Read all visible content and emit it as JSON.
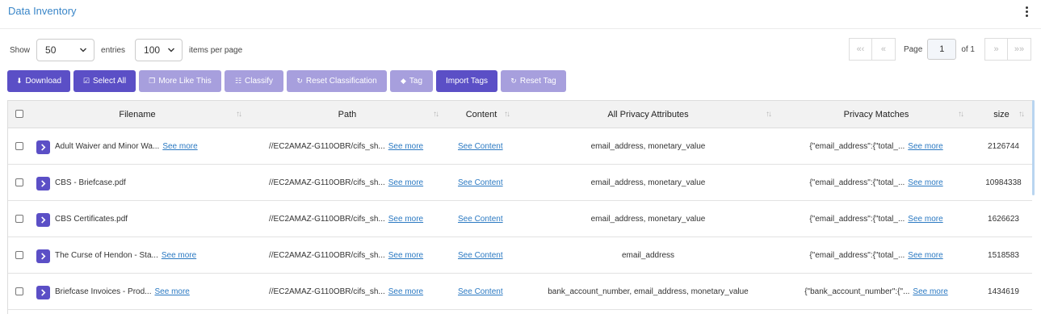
{
  "header": {
    "title": "Data Inventory",
    "menu_icon": "kebab-menu-icon"
  },
  "controls": {
    "show_label": "Show",
    "entries_value": "50",
    "entries_label": "entries",
    "items_value": "100",
    "items_label": "items per page"
  },
  "pagination": {
    "first": "«‹",
    "prev": "«",
    "page_label": "Page",
    "page_value": "1",
    "of_label": "of 1",
    "next": "»",
    "last": "»»"
  },
  "toolbar": {
    "download": "Download",
    "select_all": "Select All",
    "more_like_this": "More Like This",
    "classify": "Classify",
    "reset_classification": "Reset Classification",
    "tag": "Tag",
    "import_tags": "Import Tags",
    "reset_tag": "Reset Tag"
  },
  "table": {
    "columns": {
      "filename": "Filename",
      "path": "Path",
      "content": "Content",
      "privacy_attributes": "All Privacy Attributes",
      "privacy_matches": "Privacy Matches",
      "size": "size"
    },
    "see_more": "See more",
    "see_content": "See Content",
    "rows": [
      {
        "filename": "Adult Waiver and Minor Wa...",
        "path": "//EC2AMAZ-G110OBR/cifs_sh...",
        "attributes": "email_address, monetary_value",
        "matches": "{\"email_address\":{\"total_...",
        "size": "2126744"
      },
      {
        "filename": "CBS - Briefcase.pdf",
        "path": "//EC2AMAZ-G110OBR/cifs_sh...",
        "attributes": "email_address, monetary_value",
        "matches": "{\"email_address\":{\"total_...",
        "size": "10984338"
      },
      {
        "filename": "CBS Certificates.pdf",
        "path": "//EC2AMAZ-G110OBR/cifs_sh...",
        "attributes": "email_address, monetary_value",
        "matches": "{\"email_address\":{\"total_...",
        "size": "1626623"
      },
      {
        "filename": "The Curse of Hendon - Sta...",
        "path": "//EC2AMAZ-G110OBR/cifs_sh...",
        "attributes": "email_address",
        "matches": "{\"email_address\":{\"total_...",
        "size": "1518583"
      },
      {
        "filename": "Briefcase Invoices - Prod...",
        "path": "//EC2AMAZ-G110OBR/cifs_sh...",
        "attributes": "bank_account_number, email_address, monetary_value",
        "matches": "{\"bank_account_number\":{\"...",
        "size": "1434619"
      }
    ]
  }
}
